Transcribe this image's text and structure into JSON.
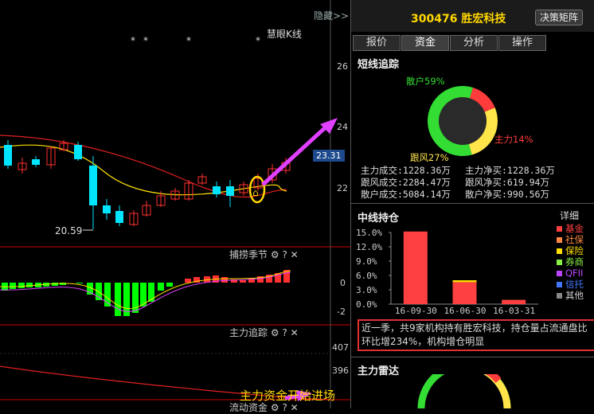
{
  "left": {
    "hide_label": "隐藏",
    "chart_name": "慧眼K线",
    "star_marks": [
      "*",
      "*",
      "*",
      "*"
    ],
    "price_axis": [
      "26",
      "24",
      "22"
    ],
    "current_price": "23.31",
    "low_price_label": "20.59",
    "indicator1": {
      "title": "捕捞季节",
      "axis": [
        "0",
        "-2"
      ]
    },
    "indicator2": {
      "title": "主力追踪",
      "axis": [
        "407",
        "396"
      ]
    },
    "indicator3": {
      "title": "流动资金"
    },
    "annotation": "主力资金开始进场",
    "colors": {
      "up": "#ff3030",
      "down": "#00e5ff",
      "ma_red": "#e02020",
      "ma_yellow": "#ffe000",
      "arrow": "#e040ff",
      "green": "#00ff00",
      "highlight": "#ffd800"
    }
  },
  "right": {
    "stock_code": "300476",
    "stock_name": "胜宏科技",
    "decision_button": "决策矩阵",
    "tabs": [
      "报价",
      "资金",
      "分析",
      "操作"
    ],
    "active_tab": "资金",
    "short_term": {
      "title": "短线追踪",
      "donut": [
        {
          "label": "散户59%",
          "value": 59,
          "color": "#33dd33"
        },
        {
          "label": "主力14%",
          "value": 14,
          "color": "#ff3b3b"
        },
        {
          "label": "跟风27%",
          "value": 27,
          "color": "#ffe44a"
        }
      ],
      "stats": [
        [
          "主力成交:1228.36万",
          "主力净买:1228.36万"
        ],
        [
          "跟风成交:2284.47万",
          "跟风净买:619.94万"
        ],
        [
          "散户成交:5084.14万",
          "散户净买:990.56万"
        ]
      ]
    },
    "mid_term": {
      "title": "中线持仓",
      "detail_link": "详细",
      "y_ticks": [
        "15.0%",
        "12.0%",
        "9.0%",
        "6.0%",
        "3.0%",
        "0.0%"
      ],
      "x_labels": [
        "16-09-30",
        "16-06-30",
        "16-03-31"
      ],
      "legend": [
        {
          "name": "基金",
          "color": "#ff4040"
        },
        {
          "name": "社保",
          "color": "#ff8844"
        },
        {
          "name": "保险",
          "color": "#ffe000"
        },
        {
          "name": "券商",
          "color": "#88ee44"
        },
        {
          "name": "QFII",
          "color": "#bb44ff"
        },
        {
          "name": "信托",
          "color": "#4477ff"
        },
        {
          "name": "其他",
          "color": "#888888"
        }
      ],
      "note": "近一季，共9家机构持有胜宏科技，持仓量占流通盘比环比增234%，机构增仓明显"
    },
    "radar": {
      "title": "主力雷达"
    }
  },
  "chart_data": [
    {
      "type": "bar",
      "title": "中线持仓",
      "categories": [
        "16-09-30",
        "16-06-30",
        "16-03-31"
      ],
      "series": [
        {
          "name": "基金",
          "values": [
            15.2,
            4.6,
            0.9
          ]
        },
        {
          "name": "保险",
          "values": [
            0,
            0.4,
            0
          ]
        }
      ],
      "ylim": [
        0,
        15
      ],
      "y_ticks": [
        "15.0%",
        "12.0%",
        "9.0%",
        "6.0%",
        "3.0%",
        "0.0%"
      ]
    },
    {
      "type": "pie",
      "title": "短线追踪",
      "categories": [
        "散户",
        "主力",
        "跟风"
      ],
      "values": [
        59,
        14,
        27
      ]
    }
  ]
}
